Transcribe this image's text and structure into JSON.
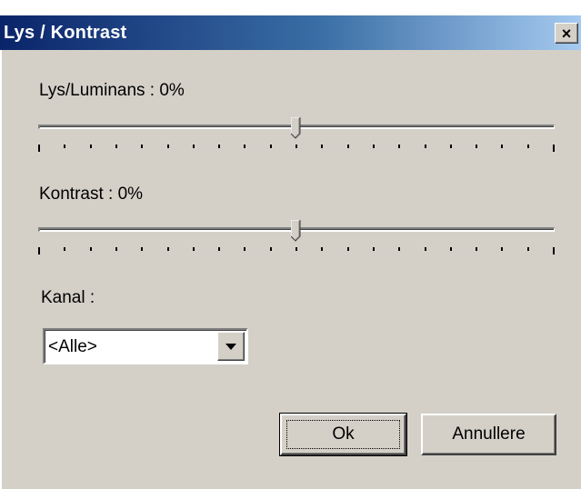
{
  "window": {
    "title": "Lys / Kontrast",
    "close_glyph": "×"
  },
  "brightness": {
    "label": "Lys/Luminans : 0%",
    "value_percent": 0,
    "range": [
      -100,
      100
    ],
    "tick_count": 21
  },
  "contrast": {
    "label": "Kontrast : 0%",
    "value_percent": 0,
    "range": [
      -100,
      100
    ],
    "tick_count": 21
  },
  "channel": {
    "label": "Kanal :",
    "selected": "<Alle>"
  },
  "buttons": {
    "ok": "Ok",
    "cancel": "Annullere"
  },
  "colors": {
    "dialog_bg": "#d4d0c8",
    "title_start": "#0a246a",
    "title_end": "#a6caf0"
  },
  "icons": {
    "close": "close-icon",
    "dropdown": "chevron-down-icon"
  }
}
